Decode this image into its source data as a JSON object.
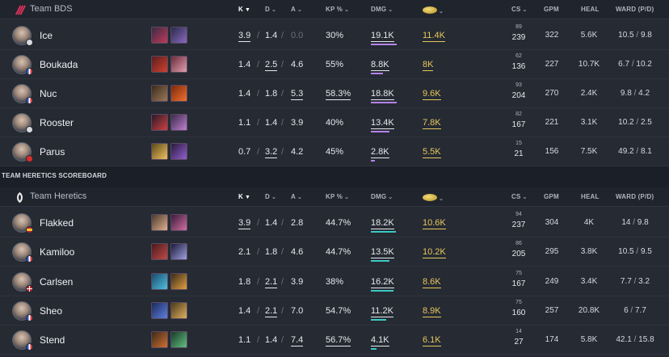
{
  "columns": {
    "k": "K",
    "d": "D",
    "a": "A",
    "kp": "KP %",
    "dmg": "DMG",
    "cs": "CS",
    "gpm": "GPM",
    "heal": "HEAL",
    "ward": "WARD (P/D)"
  },
  "colors": {
    "team1_bar": "#b683e8",
    "team2_bar": "#3cc9c5",
    "gold": "#e7c75d",
    "accent": "#37c9b6",
    "logo1": "#e0325e"
  },
  "section_title": "TEAM HERETICS SCOREBOARD",
  "teams": [
    {
      "name": "Team BDS",
      "logo_icon": "team-bds-logo",
      "players": [
        {
          "name": "Ice",
          "flag": "un",
          "k": "3.9",
          "d": "1.4",
          "a": "0.0",
          "kp": "30%",
          "dmg": "19.1K",
          "gold": "11.4K",
          "cs_min": "89",
          "cs": "239",
          "gpm": "322",
          "heal": "5.6K",
          "ward_p": "10.5",
          "ward_d": "9.8",
          "dmg_frac": 0.95,
          "champ1": [
            "#3a2b44",
            "#c03a5a"
          ],
          "champ2": [
            "#2a2a4a",
            "#8a6ac0"
          ]
        },
        {
          "name": "Boukada",
          "flag": "fr",
          "k": "1.4",
          "d": "2.5",
          "a": "4.6",
          "kp": "55%",
          "dmg": "8.8K",
          "gold": "8K",
          "cs_min": "62",
          "cs": "136",
          "gpm": "227",
          "heal": "10.7K",
          "ward_p": "6.7",
          "ward_d": "10.2",
          "dmg_frac": 0.44,
          "champ1": [
            "#5a1e1e",
            "#d04030"
          ],
          "champ2": [
            "#6a2a3a",
            "#e0a0b0"
          ]
        },
        {
          "name": "Nuc",
          "flag": "fr",
          "k": "1.4",
          "d": "1.8",
          "a": "5.3",
          "kp": "58.3%",
          "dmg": "18.8K",
          "gold": "9.6K",
          "cs_min": "93",
          "cs": "204",
          "gpm": "270",
          "heal": "2.4K",
          "ward_p": "9.8",
          "ward_d": "4.2",
          "dmg_frac": 0.94,
          "champ1": [
            "#3a2a1a",
            "#9a7a5a"
          ],
          "champ2": [
            "#7a2a0a",
            "#f07030"
          ]
        },
        {
          "name": "Rooster",
          "flag": "un",
          "k": "1.1",
          "d": "1.4",
          "a": "3.9",
          "kp": "40%",
          "dmg": "13.4K",
          "gold": "7.8K",
          "cs_min": "82",
          "cs": "167",
          "gpm": "221",
          "heal": "3.1K",
          "ward_p": "10.2",
          "ward_d": "2.5",
          "dmg_frac": 0.67,
          "champ1": [
            "#2a1a2a",
            "#d04040"
          ],
          "champ2": [
            "#3a2a4a",
            "#c080d0"
          ]
        },
        {
          "name": "Parus",
          "flag": "tr",
          "k": "0.7",
          "d": "3.2",
          "a": "4.2",
          "kp": "45%",
          "dmg": "2.8K",
          "gold": "5.5K",
          "cs_min": "15",
          "cs": "21",
          "gpm": "156",
          "heal": "7.5K",
          "ward_p": "49.2",
          "ward_d": "8.1",
          "dmg_frac": 0.14,
          "champ1": [
            "#5a4a1a",
            "#f0c060"
          ],
          "champ2": [
            "#2a1a3a",
            "#9060d0"
          ]
        }
      ]
    },
    {
      "name": "Team Heretics",
      "logo_icon": "team-heretics-logo",
      "players": [
        {
          "name": "Flakked",
          "flag": "es",
          "k": "3.9",
          "d": "1.4",
          "a": "2.8",
          "kp": "44.7%",
          "dmg": "18.2K",
          "gold": "10.6K",
          "cs_min": "94",
          "cs": "237",
          "gpm": "304",
          "heal": "4K",
          "ward_p": "14",
          "ward_d": "9.8",
          "dmg_frac": 0.91,
          "champ1": [
            "#4a3a2a",
            "#e0b090"
          ],
          "champ2": [
            "#3a1a3a",
            "#d070a0"
          ]
        },
        {
          "name": "Kamiloo",
          "flag": "fr",
          "k": "2.1",
          "d": "1.8",
          "a": "4.6",
          "kp": "44.7%",
          "dmg": "13.5K",
          "gold": "10.2K",
          "cs_min": "86",
          "cs": "205",
          "gpm": "295",
          "heal": "3.8K",
          "ward_p": "10.5",
          "ward_d": "9.5",
          "dmg_frac": 0.67,
          "champ1": [
            "#4a1a1a",
            "#c04a4a"
          ],
          "champ2": [
            "#1a1a3a",
            "#a0a0e0"
          ]
        },
        {
          "name": "Carlsen",
          "flag": "dk",
          "k": "1.8",
          "d": "2.1",
          "a": "3.9",
          "kp": "38%",
          "dmg": "16.2K",
          "gold": "8.6K",
          "cs_min": "75",
          "cs": "167",
          "gpm": "249",
          "heal": "3.4K",
          "ward_p": "7.7",
          "ward_d": "3.2",
          "dmg_frac": 0.81,
          "champ1": [
            "#1a4a6a",
            "#50c0e0"
          ],
          "champ2": [
            "#3a2a1a",
            "#e0a040"
          ]
        },
        {
          "name": "Sheo",
          "flag": "fr",
          "k": "1.4",
          "d": "2.1",
          "a": "7.0",
          "kp": "54.7%",
          "dmg": "11.2K",
          "gold": "8.9K",
          "cs_min": "75",
          "cs": "160",
          "gpm": "257",
          "heal": "20.8K",
          "ward_p": "6",
          "ward_d": "7.7",
          "dmg_frac": 0.56,
          "champ1": [
            "#1a2a5a",
            "#6080e0"
          ],
          "champ2": [
            "#4a3a1a",
            "#e0b060"
          ]
        },
        {
          "name": "Stend",
          "flag": "fr",
          "k": "1.1",
          "d": "1.4",
          "a": "7.4",
          "kp": "56.7%",
          "dmg": "4.1K",
          "gold": "6.1K",
          "cs_min": "14",
          "cs": "27",
          "gpm": "174",
          "heal": "5.8K",
          "ward_p": "42.1",
          "ward_d": "15.8",
          "dmg_frac": 0.2,
          "champ1": [
            "#3a2a1a",
            "#d07030"
          ],
          "champ2": [
            "#1a3a2a",
            "#60c080"
          ]
        }
      ]
    }
  ],
  "underlines": {
    "t0": [
      [
        "k",
        "dmg",
        "gold"
      ],
      [
        "d",
        "dmg",
        "gold"
      ],
      [
        "a",
        "kp",
        "dmg",
        "gold"
      ],
      [
        "dmg",
        "gold"
      ],
      [
        "d",
        "dmg",
        "gold"
      ]
    ],
    "t1": [
      [
        "k",
        "dmg",
        "gold"
      ],
      [
        "dmg",
        "gold"
      ],
      [
        "d",
        "dmg",
        "gold"
      ],
      [
        "d",
        "dmg",
        "gold"
      ],
      [
        "a",
        "kp",
        "dmg",
        "gold"
      ]
    ]
  }
}
